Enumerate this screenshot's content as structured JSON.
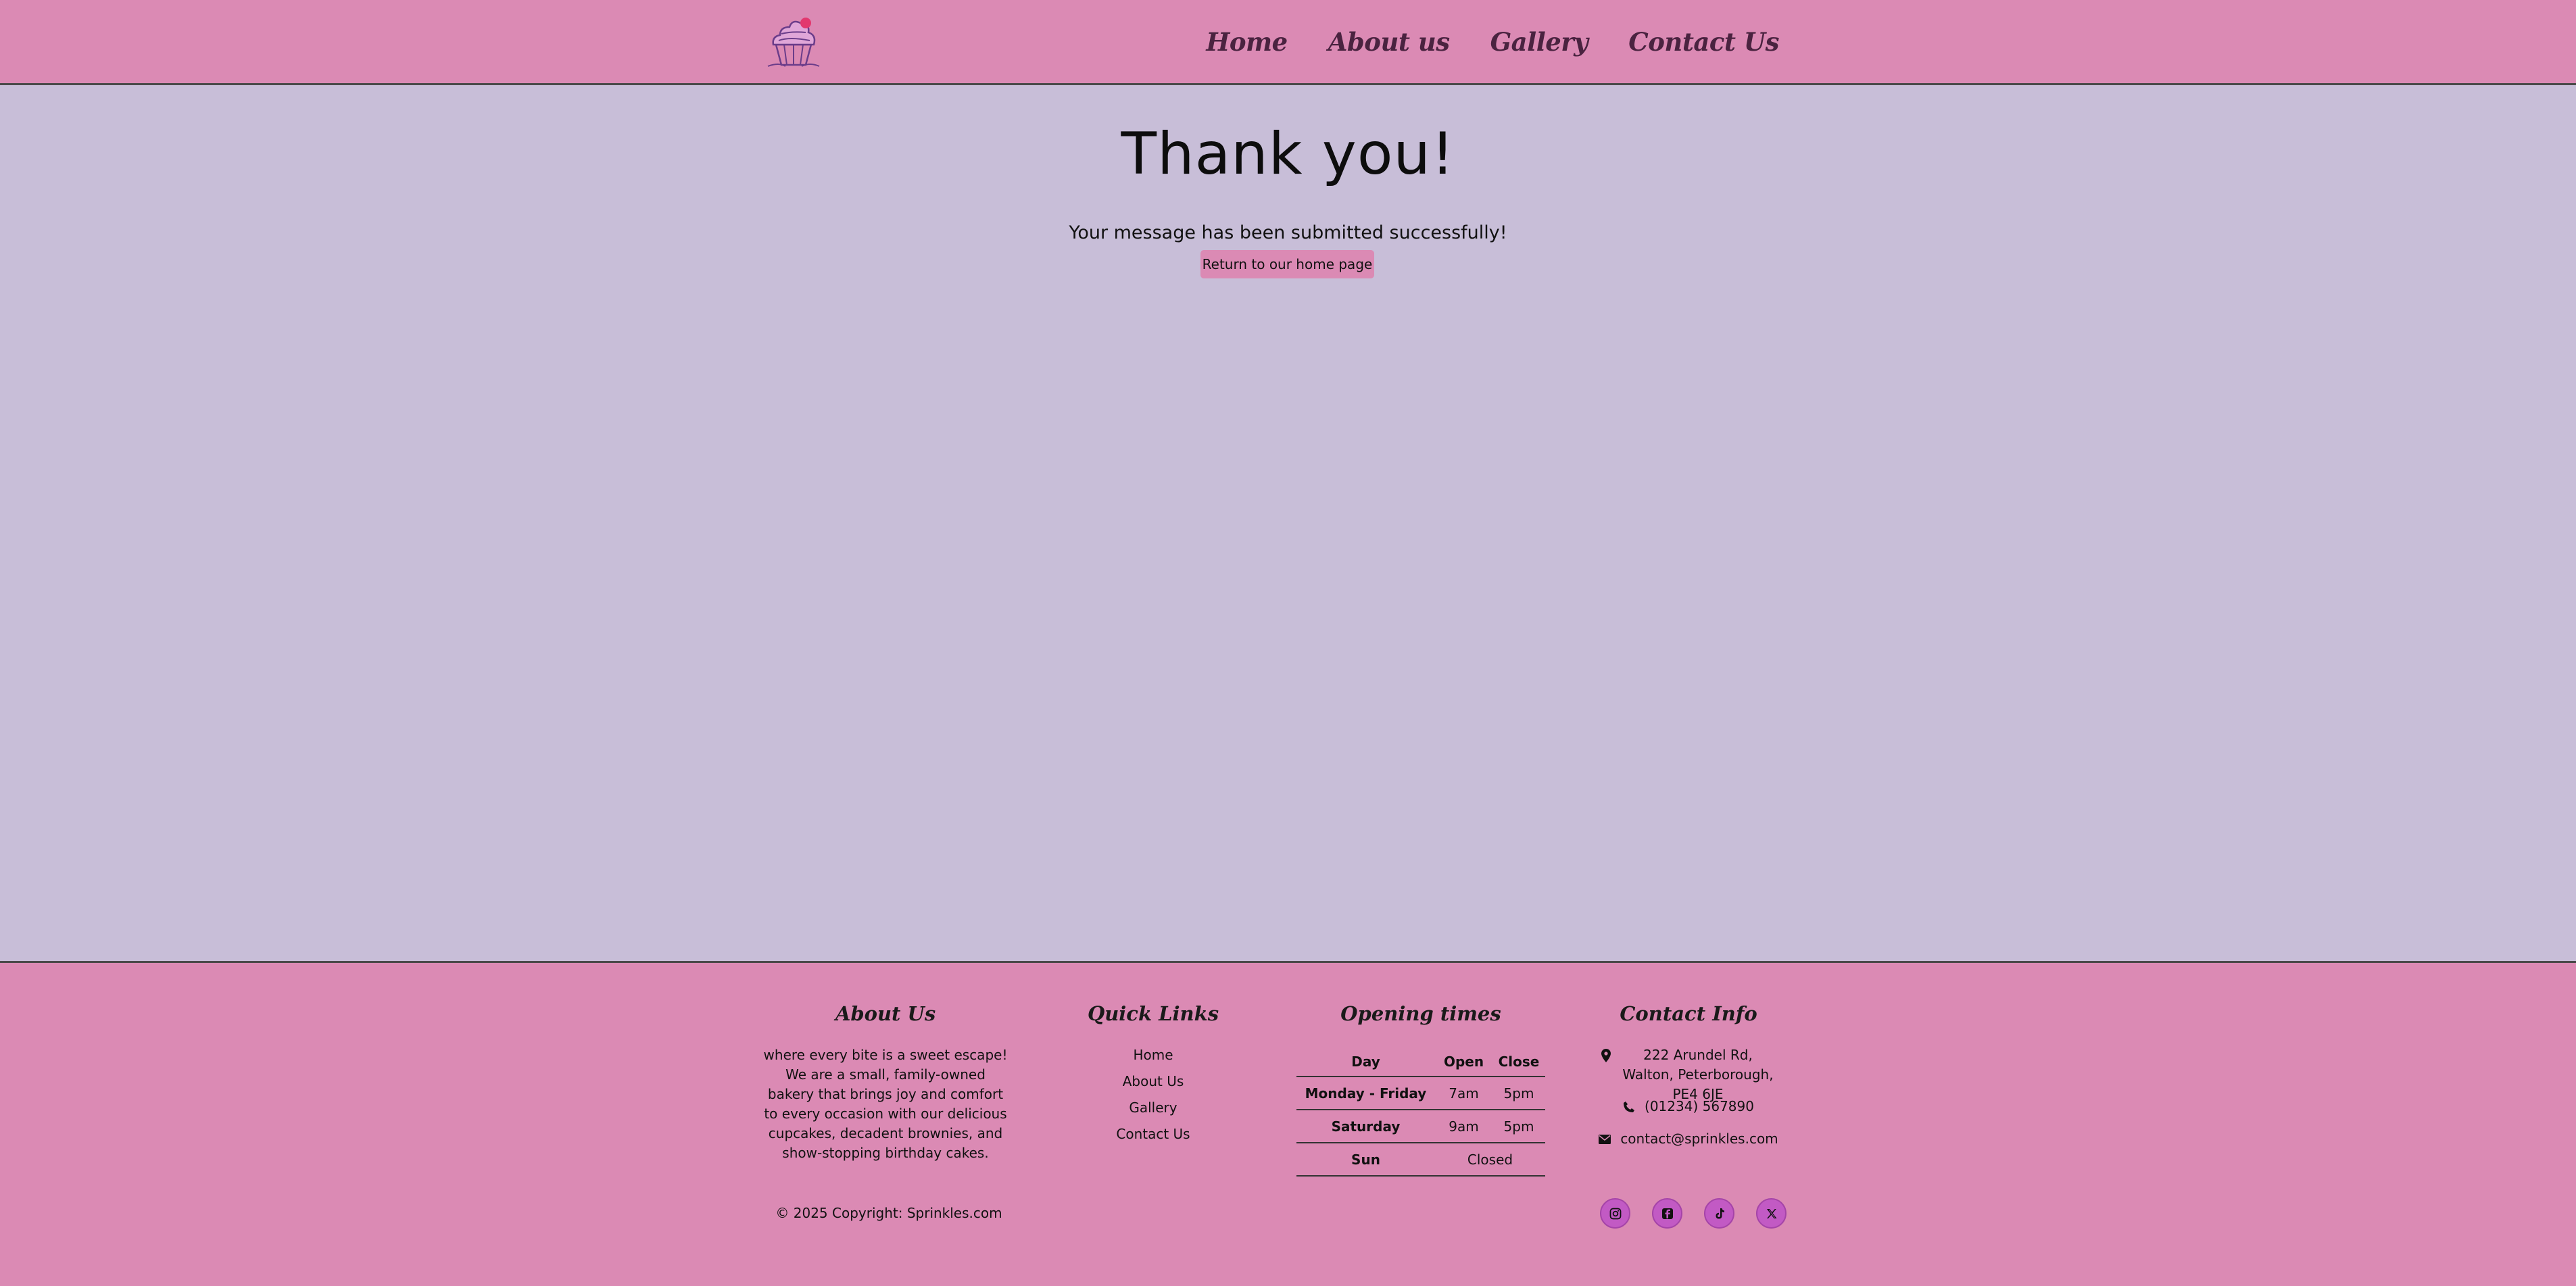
{
  "nav": {
    "logo_icon": "cupcake-logo-icon",
    "items": [
      {
        "label": "Home"
      },
      {
        "label": "About us"
      },
      {
        "label": "Gallery"
      },
      {
        "label": "Contact Us"
      }
    ]
  },
  "main": {
    "title": "Thank you!",
    "message": "Your message has been submitted successfully!",
    "button_label": "Return to our home page"
  },
  "footer": {
    "about": {
      "heading": "About Us",
      "text": "where every bite is a sweet escape! We are a small, family-owned bakery that brings joy and comfort to every occasion with our delicious cupcakes, decadent brownies, and show-stopping birthday cakes."
    },
    "quick_links": {
      "heading": "Quick Links",
      "items": [
        "Home",
        "About Us",
        "Gallery",
        "Contact Us"
      ]
    },
    "opening_times": {
      "heading": "Opening times",
      "columns": [
        "Day",
        "Open",
        "Close"
      ],
      "rows": [
        {
          "day": "Monday - Friday",
          "open": "7am",
          "close": "5pm"
        },
        {
          "day": "Saturday",
          "open": "9am",
          "close": "5pm"
        },
        {
          "day": "Sun",
          "status": "Closed"
        }
      ]
    },
    "contact": {
      "heading": "Contact Info",
      "address": "222 Arundel Rd, Walton, Peterborough, PE4 6JE",
      "phone": "(01234) 567890",
      "email": "contact@sprinkles.com"
    },
    "copyright": "© 2025 Copyright: Sprinkles.com",
    "social": [
      "instagram-icon",
      "facebook-icon",
      "tiktok-icon",
      "x-icon"
    ]
  },
  "colors": {
    "header_bg": "#db8ab4",
    "page_bg": "#c8bed8",
    "social_bg": "#c25ac4",
    "nav_text": "#4a2340"
  }
}
